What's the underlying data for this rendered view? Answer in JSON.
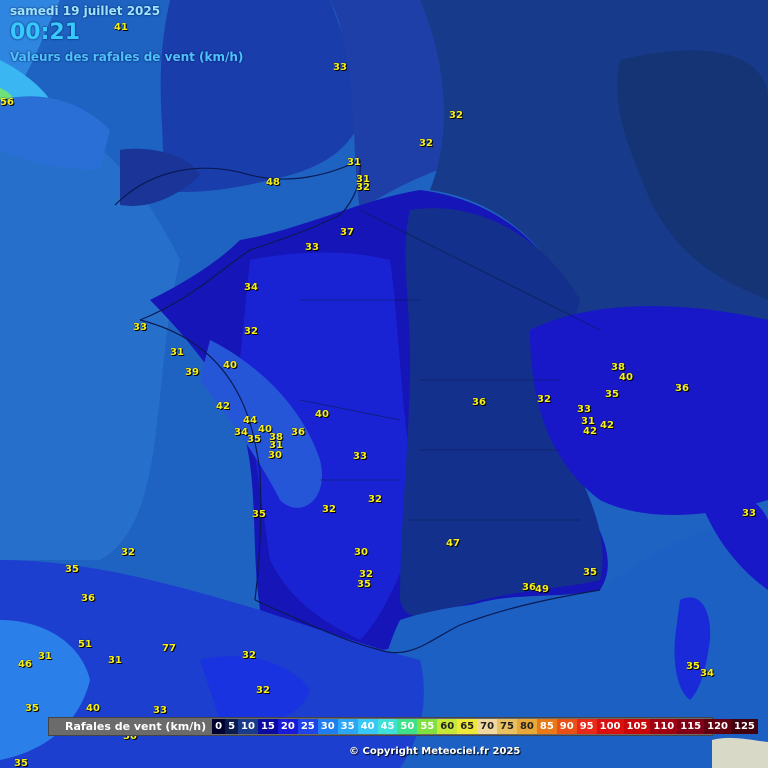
{
  "header": {
    "date": "samedi 19 juillet 2025",
    "time": "00:21",
    "subtitle": "Valeurs des rafales de vent (km/h)"
  },
  "legend": {
    "title": "Rafales de vent (km/h)",
    "classes": [
      {
        "label": "0",
        "color": "#000030"
      },
      {
        "label": "5",
        "color": "#0a1c4d"
      },
      {
        "label": "10",
        "color": "#1a3a8a"
      },
      {
        "label": "15",
        "color": "#0b0ba0"
      },
      {
        "label": "20",
        "color": "#1a1ad8"
      },
      {
        "label": "25",
        "color": "#1f45e8"
      },
      {
        "label": "30",
        "color": "#1e7ef0"
      },
      {
        "label": "35",
        "color": "#2aa6f5"
      },
      {
        "label": "40",
        "color": "#38c8f8"
      },
      {
        "label": "45",
        "color": "#3fe0d8"
      },
      {
        "label": "50",
        "color": "#3ee08a"
      },
      {
        "label": "55",
        "color": "#7fe040"
      },
      {
        "label": "60",
        "color": "#c8e838"
      },
      {
        "label": "65",
        "color": "#f0e838"
      },
      {
        "label": "70",
        "color": "#f0d8a0"
      },
      {
        "label": "75",
        "color": "#e8c060"
      },
      {
        "label": "80",
        "color": "#e8a838"
      },
      {
        "label": "85",
        "color": "#e87818"
      },
      {
        "label": "90",
        "color": "#e85018"
      },
      {
        "label": "95",
        "color": "#e82818"
      },
      {
        "label": "100",
        "color": "#d81010"
      },
      {
        "label": "105",
        "color": "#c80808"
      },
      {
        "label": "110",
        "color": "#a00010"
      },
      {
        "label": "115",
        "color": "#800018"
      },
      {
        "label": "120",
        "color": "#600010"
      },
      {
        "label": "125",
        "color": "#400010"
      }
    ]
  },
  "gust_values": [
    "41",
    "56",
    "33",
    "32",
    "32",
    "31",
    "31",
    "32",
    "48",
    "37",
    "33",
    "34",
    "33",
    "32",
    "31",
    "40",
    "39",
    "42",
    "44",
    "34",
    "40",
    "38",
    "35",
    "31",
    "30",
    "36",
    "40",
    "33",
    "32",
    "32",
    "35",
    "32",
    "35",
    "36",
    "30",
    "32",
    "35",
    "47",
    "35",
    "36",
    "32",
    "38",
    "40",
    "36",
    "35",
    "33",
    "31",
    "42",
    "42",
    "33",
    "35",
    "34",
    "36",
    "49",
    "51",
    "46",
    "31",
    "31",
    "77",
    "32",
    "32",
    "40",
    "33",
    "35",
    "30",
    "35"
  ],
  "copyright": "© Copyright Meteociel.fr 2025"
}
